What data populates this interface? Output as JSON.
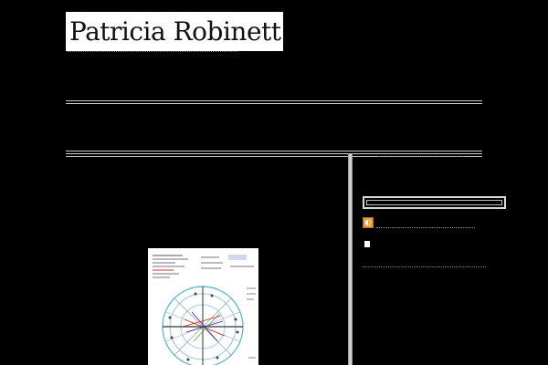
{
  "header": {
    "site_title": "Patricia Robinett"
  },
  "main": {
    "featured_image": {
      "alt_subject": "natal-chart-wheel"
    }
  },
  "sidebar": {
    "feed_icon": "rss-feed-icon",
    "bullet_icon": "square-bullet-icon"
  },
  "colors": {
    "background": "#000000",
    "rule": "#cfcfcf",
    "title_box": "#ffffff",
    "feed_icon": "#e8a23a"
  }
}
